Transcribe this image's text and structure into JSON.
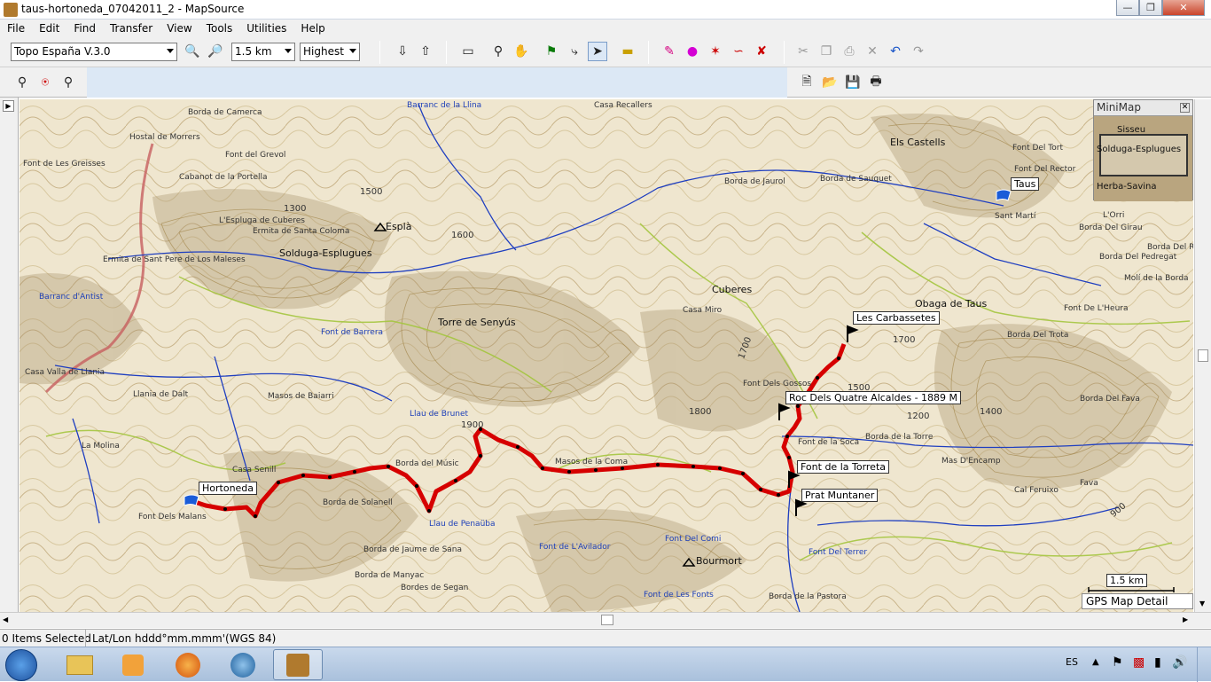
{
  "window": {
    "title": "taus-hortoneda_07042011_2 - MapSource"
  },
  "menu": [
    "File",
    "Edit",
    "Find",
    "Transfer",
    "View",
    "Tools",
    "Utilities",
    "Help"
  ],
  "toolbar": {
    "map_product": "Topo España V.3.0",
    "zoom_level": "1.5 km",
    "detail": "Highest"
  },
  "map": {
    "waypoints": [
      {
        "label": "Hortoneda"
      },
      {
        "label": "Taus"
      },
      {
        "label": "Les Carbassetes"
      },
      {
        "label": "Roc Dels Quatre Alcaldes - 1889 M"
      },
      {
        "label": "Font de la Torreta"
      },
      {
        "label": "Prat Muntaner"
      }
    ],
    "places": [
      "Borda de Camerca",
      "Hostal de Morrers",
      "Font del Grevol",
      "Font de Les Greisses",
      "Cabanot de la Portella",
      "L'Espluga de Cuberes",
      "Ermita de Santa Coloma",
      "Ermita de Sant Pere de Los Maleses",
      "Solduga-Esplugues",
      "Esplà",
      "Torre de Senyús",
      "Barranc de la Llina",
      "Casa Recallers",
      "Barranc d'Antist",
      "Casa Valla de Llania",
      "Llania de Dalt",
      "Masos de Baiarri",
      "Font de Barrera",
      "La Molina",
      "Font Dels Malans",
      "Casa Senill",
      "Borda del Músic",
      "Borda de Solanell",
      "Borda de Jaume de Sana",
      "Borda de Manyac",
      "Bordes de Segan",
      "Font de L'Avilador",
      "Font Del Comi",
      "Bourmort",
      "Font Del Terrer",
      "Borda de la Pastora",
      "Font de Les Fonts",
      "Masos de la Coma",
      "Cuberes",
      "Casa Miro",
      "Els Castells",
      "Sant Martí",
      "Font Del Rector",
      "Borda de Jaurol",
      "Borda de Sauquet",
      "Borda Del Girau",
      "Borda Del Rei",
      "Borda Del Pedregat",
      "Molí de la Borda",
      "Font De L'Heura",
      "Borda Del Trota",
      "Borda Del Fava",
      "Mas D'Encamp",
      "Cal Feruixo",
      "Borda de la Torre",
      "Font Dels Gossos",
      "Font de la Soca",
      "Obaga de Taus",
      "Llau de Penaüba",
      "Llau de Brunet",
      "L'Orri",
      "Font Del Tort",
      "Fava"
    ],
    "elevations": [
      "1300",
      "1500",
      "1600",
      "1700",
      "1800",
      "1900",
      "1200",
      "1400",
      "1500",
      "1700",
      "900"
    ],
    "scale": "1.5 km",
    "detail_label": "GPS Map Detail",
    "minimap": {
      "title": "MiniMap",
      "labels": [
        "Solduga-Esplugues",
        "Herba-Savina",
        "Sisseu"
      ]
    }
  },
  "status": {
    "items_selected": "0 Items Selected",
    "coord_format": "Lat/Lon hddd°mm.mmm'(WGS 84)"
  },
  "taskbar": {
    "language": "ES"
  },
  "colors": {
    "track": "#d60000",
    "water": "#1e3ec0",
    "contour_major": "#9a7b3a",
    "road": "#a4c53f",
    "map_bg": "#efe6cf"
  }
}
